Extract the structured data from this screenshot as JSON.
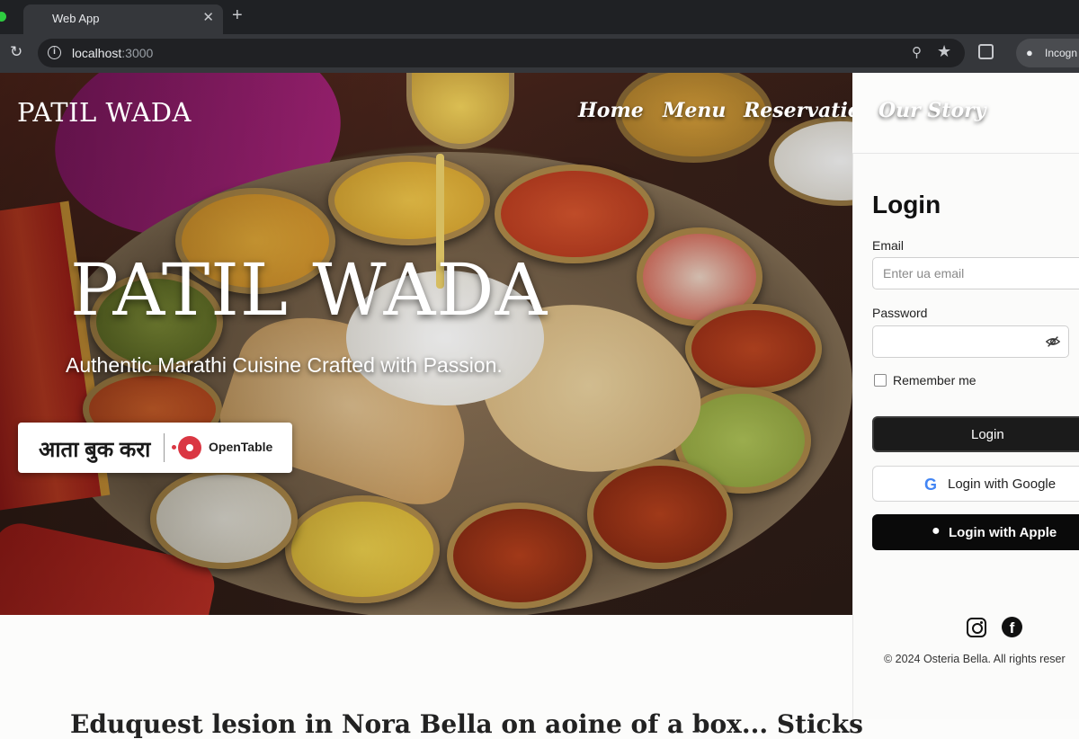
{
  "browser": {
    "tab_title": "Web App",
    "tab_close": "✕",
    "new_tab": "+",
    "url_host": "localhost",
    "url_port": ":3000",
    "profile_label": "Incogn"
  },
  "site": {
    "brand": "PATIL WADA",
    "nav": [
      "Home",
      "Menu",
      "Reservation",
      "Our Story"
    ],
    "hero_title": "PATIL WADA",
    "hero_subtitle": "Authentic Marathi Cuisine Crafted with Passion.",
    "booking": {
      "label": "आता बुक करा",
      "provider": "OpenTable"
    },
    "lower_heading": "Eduquest lesion in Nora Bella on aoine of a box... Sticks"
  },
  "login": {
    "title": "Login",
    "email_label": "Email",
    "email_placeholder": "Enter ua email",
    "password_label": "Password",
    "remember_label": "Remember me",
    "login_button": "Login",
    "google_button": "Login with Google",
    "apple_button": "Login with Apple",
    "copyright": "© 2024 Osteria Bella. All rights reser"
  },
  "colors": {
    "accent": "#1b1b1b",
    "opentable_red": "#da3743",
    "chrome_bg": "#35373b"
  },
  "icons": [
    "reload-icon",
    "info-icon",
    "zoom-icon",
    "star-icon",
    "extension-icon",
    "profile-icon",
    "eye-slash-icon",
    "google-icon",
    "apple-icon",
    "instagram-icon",
    "facebook-icon",
    "opentable-icon"
  ]
}
